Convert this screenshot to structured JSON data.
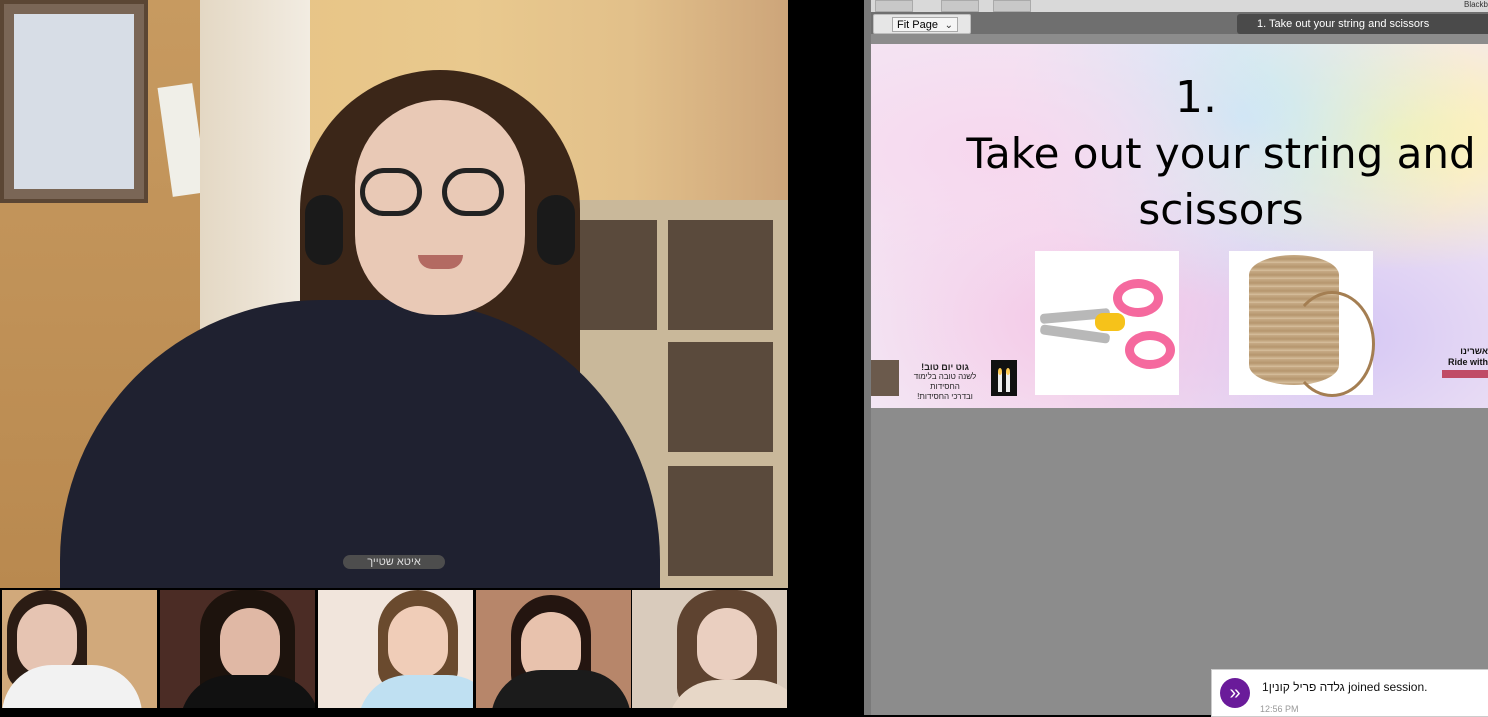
{
  "main_video": {
    "participant_name": "איטא שטייך"
  },
  "thumbnails": [
    {
      "shirt": "#f2f2f2",
      "hair": "#2b1c14",
      "bg": "#d1a97b"
    },
    {
      "shirt": "#111111",
      "hair": "#1d130d",
      "bg": "#4b2c25"
    },
    {
      "shirt": "#bfe0f2",
      "hair": "#6a4a2e",
      "bg": "#f1e5dc"
    },
    {
      "shirt": "#1b1b1b",
      "hair": "#241510",
      "bg": "#b7866a"
    },
    {
      "shirt": "#e7d7c7",
      "hair": "#5e4330",
      "bg": "#d9cbbc"
    }
  ],
  "presentation": {
    "top_right_text": "Blackb",
    "zoom_select": "Fit Page",
    "slide_title": "1. Take out your string and scissors",
    "slide": {
      "number": "1.",
      "heading_line1": "Take out your string and",
      "heading_line2": "scissors",
      "hebrew_title": "גוט יום טוב!",
      "hebrew_line2": "לשנה טובה בלימוד החסידות",
      "hebrew_line3": "ובדרכי החסידות!",
      "right_logo_hebrew": "אשרינו",
      "right_logo_english": "Ride with"
    }
  },
  "notification": {
    "name": "גלדה פריל קונין1",
    "message": "joined session.",
    "time": "12:56 PM"
  }
}
